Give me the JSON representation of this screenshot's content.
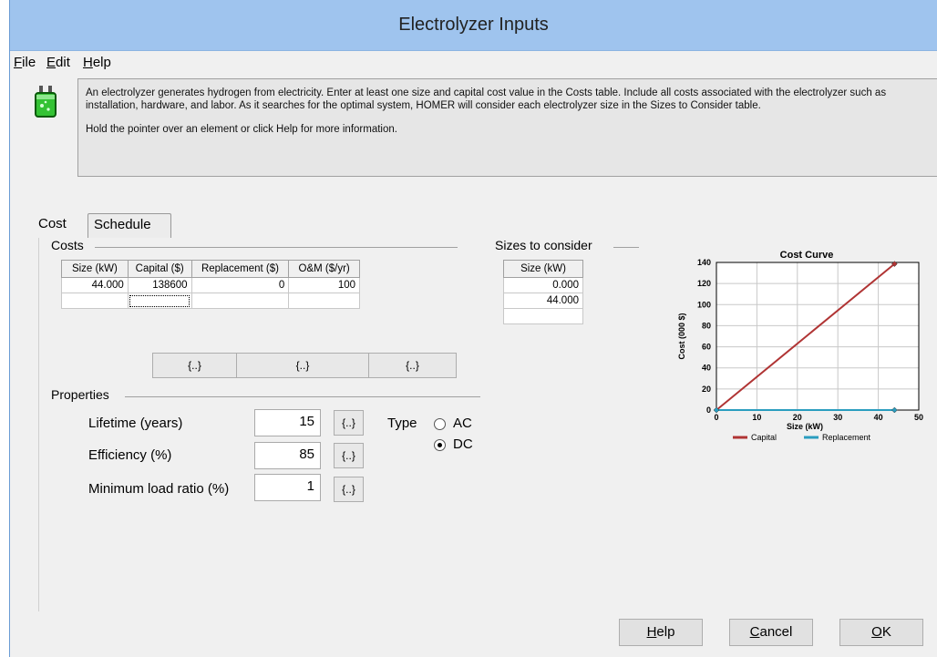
{
  "window": {
    "title": "Electrolyzer Inputs"
  },
  "menu": [
    {
      "hotkey": "F",
      "rest": "ile"
    },
    {
      "hotkey": "E",
      "rest": "dit"
    },
    {
      "hotkey": "H",
      "rest": "elp"
    }
  ],
  "info": {
    "paragraph1": "An electrolyzer generates hydrogen from electricity. Enter at least one size and capital cost value in the Costs table.  Include all costs associated with the electrolyzer such as installation, hardware, and labor. As it searches for the optimal system, HOMER will consider each electrolyzer size in the Sizes to Consider table.",
    "paragraph2": "Hold the pointer over an element or click Help for more information."
  },
  "tabs": {
    "cost": "Cost",
    "schedule": "Schedule"
  },
  "costs": {
    "label": "Costs",
    "headers": [
      "Size (kW)",
      "Capital ($)",
      "Replacement ($)",
      "O&M ($/yr)"
    ],
    "rows": [
      [
        "44.000",
        "138600",
        "0",
        "100"
      ],
      [
        "",
        "",
        "",
        ""
      ]
    ]
  },
  "sizes": {
    "label": "Sizes to consider",
    "header": "Size (kW)",
    "rows": [
      "0.000",
      "44.000",
      ""
    ]
  },
  "sensitivity_buttons": [
    "{..}",
    "{..}",
    "{..}"
  ],
  "properties": {
    "label": "Properties",
    "lifetime_label": "Lifetime (years)",
    "lifetime_value": "15",
    "efficiency_label": "Efficiency (%)",
    "efficiency_value": "85",
    "minload_label": "Minimum load ratio (%)",
    "minload_value": "1",
    "sens_button": "{..}",
    "type_label": "Type",
    "type_ac": "AC",
    "type_dc": "DC",
    "type_selected": "DC"
  },
  "footer": {
    "help": {
      "hotkey": "H",
      "rest": "elp"
    },
    "cancel": {
      "hotkey": "C",
      "rest": "ancel"
    },
    "ok": {
      "hotkey": "O",
      "rest": "K"
    }
  },
  "chart_data": {
    "type": "line",
    "title": "Cost Curve",
    "xlabel": "Size (kW)",
    "ylabel": "Cost (000 $)",
    "xlim": [
      0,
      50
    ],
    "ylim": [
      0,
      140
    ],
    "xticks": [
      "0",
      "10",
      "20",
      "30",
      "40",
      "50"
    ],
    "yticks": [
      "0",
      "20",
      "40",
      "60",
      "80",
      "100",
      "120",
      "140"
    ],
    "grid": true,
    "legend": "bottom",
    "series": [
      {
        "name": "Capital",
        "color": "#b03434",
        "x": [
          0,
          44
        ],
        "y": [
          0,
          138.6
        ]
      },
      {
        "name": "Replacement",
        "color": "#2a9dbf",
        "x": [
          0,
          44
        ],
        "y": [
          0,
          0
        ]
      }
    ]
  }
}
